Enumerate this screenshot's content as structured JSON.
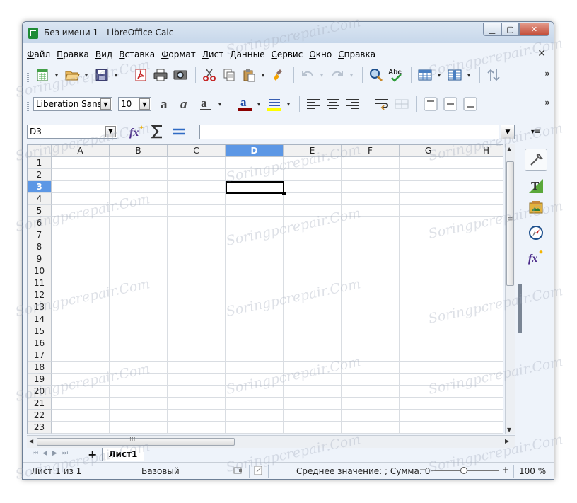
{
  "window": {
    "title": "Без имени 1 - LibreOffice Calc"
  },
  "menu": [
    "Файл",
    "Правка",
    "Вид",
    "Вставка",
    "Формат",
    "Лист",
    "Данные",
    "Сервис",
    "Окно",
    "Справка"
  ],
  "formatting": {
    "font_name": "Liberation Sans",
    "font_size": "10"
  },
  "formula_bar": {
    "name_box": "D3",
    "input_value": ""
  },
  "sheet": {
    "columns": [
      "A",
      "B",
      "C",
      "D",
      "E",
      "F",
      "G",
      "H"
    ],
    "selected_column": "D",
    "rows": [
      "1",
      "2",
      "3",
      "4",
      "5",
      "6",
      "7",
      "8",
      "9",
      "10",
      "11",
      "12",
      "13",
      "14",
      "15",
      "16",
      "17",
      "18",
      "19",
      "20",
      "21",
      "22",
      "23"
    ],
    "selected_row": "3"
  },
  "tabs": {
    "add_label": "+",
    "sheet_name": "Лист1"
  },
  "status": {
    "sheet_pos": "Лист 1 из 1",
    "page_style": "Базовый",
    "summary": "Среднее значение: ; Сумма: 0",
    "zoom_minus": "−",
    "zoom_plus": "+",
    "zoom": "100 %"
  },
  "watermark": "Soringpcrepair.Com",
  "icons": [
    "new-spreadsheet-icon",
    "open-icon",
    "save-icon",
    "export-pdf-icon",
    "print-icon",
    "print-preview-icon",
    "cut-icon",
    "copy-icon",
    "paste-icon",
    "clone-formatting-icon",
    "undo-icon",
    "redo-icon",
    "find-replace-icon",
    "spelling-icon",
    "row-icon",
    "column-icon",
    "sort-icon",
    "bold-icon",
    "italic-icon",
    "underline-icon",
    "font-color-icon",
    "highlight-icon",
    "align-left-icon",
    "align-center-icon",
    "align-right-icon",
    "wrap-text-icon",
    "merge-cells-icon",
    "function-wizard-icon",
    "sum-icon",
    "formula-icon",
    "properties-icon",
    "styles-icon",
    "gallery-icon",
    "navigator-icon",
    "functions-icon"
  ],
  "colors": {
    "selection": "#5c97e5",
    "font_color": "#8b0000",
    "highlight": "#ffff00",
    "window_bg": "#eef3fa"
  }
}
